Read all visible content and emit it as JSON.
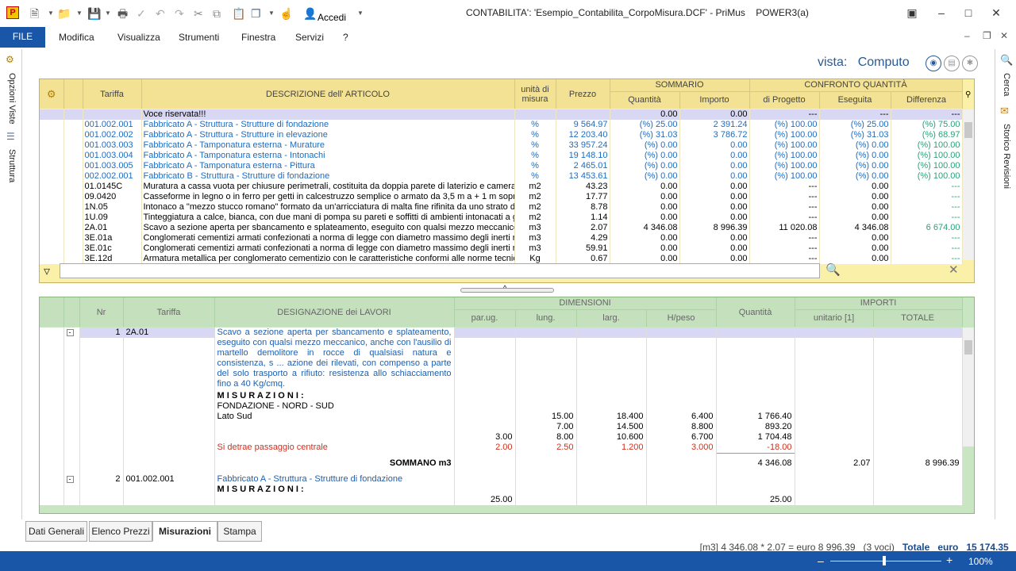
{
  "title": "CONTABILITA': 'Esempio_Contabilita_CorpoMisura.DCF' - PriMus    POWER3(a)",
  "toolbar": {
    "accedi": "Accedi"
  },
  "menu": {
    "file": "FILE",
    "items": [
      "Modifica",
      "Visualizza",
      "Strumenti",
      "Finestra",
      "Servizi",
      "?"
    ]
  },
  "left_tabs": [
    "Opzioni Viste",
    "Struttura"
  ],
  "right_tabs": [
    "Cerca",
    "Storico Revisioni"
  ],
  "vista": {
    "label": "vista:",
    "value": "Computo"
  },
  "top_grid": {
    "headers": {
      "tariffa": "Tariffa",
      "descrizione": "DESCRIZIONE dell' ARTICOLO",
      "um": "unità di misura",
      "prezzo": "Prezzo",
      "sommario": "SOMMARIO",
      "quantita": "Quantità",
      "importo": "Importo",
      "confronto": "CONFRONTO QUANTITÀ",
      "progetto": "di Progetto",
      "eseguita": "Eseguita",
      "differenza": "Differenza"
    },
    "rows": [
      {
        "t": "",
        "d": "Voce riservata!!!",
        "u": "",
        "p": "",
        "q": "0.00",
        "i": "0.00",
        "dp": "---",
        "e": "---",
        "df": "---",
        "style": "hl"
      },
      {
        "t": "001.002.001",
        "d": "Fabbricato A - Struttura - Strutture di fondazione",
        "u": "%",
        "p": "9 564.97",
        "q": "(%) 25.00",
        "i": "2 391.24",
        "dp": "(%) 100.00",
        "e": "(%) 25.00",
        "df": "(%) 75.00",
        "style": "blue"
      },
      {
        "t": "001.002.002",
        "d": "Fabbricato A - Struttura - Strutture in elevazione",
        "u": "%",
        "p": "12 203.40",
        "q": "(%) 31.03",
        "i": "3 786.72",
        "dp": "(%) 100.00",
        "e": "(%) 31.03",
        "df": "(%) 68.97",
        "style": "blue"
      },
      {
        "t": "001.003.003",
        "d": "Fabbricato A - Tamponatura esterna - Murature",
        "u": "%",
        "p": "33 957.24",
        "q": "(%) 0.00",
        "i": "0.00",
        "dp": "(%) 100.00",
        "e": "(%) 0.00",
        "df": "(%) 100.00",
        "style": "blue"
      },
      {
        "t": "001.003.004",
        "d": "Fabbricato A - Tamponatura esterna - Intonachi",
        "u": "%",
        "p": "19 148.10",
        "q": "(%) 0.00",
        "i": "0.00",
        "dp": "(%) 100.00",
        "e": "(%) 0.00",
        "df": "(%) 100.00",
        "style": "blue"
      },
      {
        "t": "001.003.005",
        "d": "Fabbricato A - Tamponatura esterna - Pittura",
        "u": "%",
        "p": "2 465.01",
        "q": "(%) 0.00",
        "i": "0.00",
        "dp": "(%) 100.00",
        "e": "(%) 0.00",
        "df": "(%) 100.00",
        "style": "blue"
      },
      {
        "t": "002.002.001",
        "d": "Fabbricato B - Struttura - Strutture di fondazione",
        "u": "%",
        "p": "13 453.61",
        "q": "(%) 0.00",
        "i": "0.00",
        "dp": "(%) 100.00",
        "e": "(%) 0.00",
        "df": "(%) 100.00",
        "style": "blue"
      },
      {
        "t": "01.0145C",
        "d": "Muratura a cassa vuota per chiusure perimetrali, costituita da doppia parete di laterizio e camera",
        "u": "m2",
        "p": "43.23",
        "q": "0.00",
        "i": "0.00",
        "dp": "---",
        "e": "0.00",
        "df": "---",
        "style": ""
      },
      {
        "t": "09.0420",
        "d": "Casseforme in legno o in ferro per getti in calcestruzzo semplice o armato da 3,5 m a + 1 m sopra",
        "u": "m2",
        "p": "17.77",
        "q": "0.00",
        "i": "0.00",
        "dp": "---",
        "e": "0.00",
        "df": "---",
        "style": ""
      },
      {
        "t": "1N.05",
        "d": "Intonaco a \"mezzo stucco romano\" formato da un'arricciatura di malta fine rifinita da uno strato d",
        "u": "m2",
        "p": "8.78",
        "q": "0.00",
        "i": "0.00",
        "dp": "---",
        "e": "0.00",
        "df": "---",
        "style": ""
      },
      {
        "t": "1U.09",
        "d": "Tinteggiatura a calce, bianca, con due mani di pompa su pareti e soffitti di ambienti intonacati a g",
        "u": "m2",
        "p": "1.14",
        "q": "0.00",
        "i": "0.00",
        "dp": "---",
        "e": "0.00",
        "df": "---",
        "style": ""
      },
      {
        "t": "2A.01",
        "d": "Scavo a sezione aperta per sbancamento e splateamento, eseguito con qualsi mezzo meccanico,",
        "u": "m3",
        "p": "2.07",
        "q": "4 346.08",
        "i": "8 996.39",
        "dp": "11 020.08",
        "e": "4 346.08",
        "df": "6 674.00",
        "style": ""
      },
      {
        "t": "3E.01a",
        "d": "Conglomerati cementizi armati confezionati a norma di legge con diametro massimo degli inerti nor",
        "u": "m3",
        "p": "4.29",
        "q": "0.00",
        "i": "0.00",
        "dp": "---",
        "e": "0.00",
        "df": "---",
        "style": ""
      },
      {
        "t": "3E.01c",
        "d": "Conglomerati cementizi armati confezionati a norma di legge con diametro massimo degli inerti nor",
        "u": "m3",
        "p": "59.91",
        "q": "0.00",
        "i": "0.00",
        "dp": "---",
        "e": "0.00",
        "df": "---",
        "style": ""
      },
      {
        "t": "3E.12d",
        "d": "Armatura metallica per conglomerato cementizio con le caratteristiche conformi alle norme tecnich",
        "u": "Kg",
        "p": "0.67",
        "q": "0.00",
        "i": "0.00",
        "dp": "---",
        "e": "0.00",
        "df": "---",
        "style": ""
      }
    ]
  },
  "bottom_grid": {
    "headers": {
      "nr": "Nr",
      "tariffa": "Tariffa",
      "designazione": "DESIGNAZIONE dei LAVORI",
      "dimensioni": "DIMENSIONI",
      "parug": "par.ug.",
      "lung": "lung.",
      "larg": "larg.",
      "hpeso": "H/peso",
      "quantita": "Quantità",
      "importi": "IMPORTI",
      "unitario": "unitario [1]",
      "totale": "TOTALE"
    },
    "item1": {
      "nr": "1",
      "tariffa": "2A.01",
      "descrizione": "Scavo a sezione aperta per sbancamento e splateamento, eseguito con qualsi mezzo meccanico, anche con l'ausilio di martello demolitore in rocce di qualsiasi natura e consistenza, s ... azione dei rilevati, con compenso a parte del solo trasporto a rifiuto: resistenza allo schiacciamento fino a 40 Kg/cmq.",
      "misurazioni": "M I S U R A Z I O N I :",
      "lines": [
        {
          "label": "FONDAZIONE - NORD - SUD",
          "pu": "",
          "lu": "",
          "la": "",
          "h": "",
          "q": "",
          "red": false
        },
        {
          "label": "Lato Sud",
          "pu": "",
          "lu": "15.00",
          "la": "18.400",
          "h": "6.400",
          "q": "1 766.40",
          "red": false
        },
        {
          "label": "",
          "pu": "",
          "lu": "7.00",
          "la": "14.500",
          "h": "8.800",
          "q": "893.20",
          "red": false
        },
        {
          "label": "",
          "pu": "3.00",
          "lu": "8.00",
          "la": "10.600",
          "h": "6.700",
          "q": "1 704.48",
          "red": false
        },
        {
          "label": "Si detrae passaggio centrale",
          "pu": "2.00",
          "lu": "2.50",
          "la": "1.200",
          "h": "3.000",
          "q": "-18.00",
          "red": true
        }
      ],
      "sommano_label": "SOMMANO m3",
      "sommano_q": "4 346.08",
      "unitario": "2.07",
      "totale": "8 996.39"
    },
    "item2": {
      "nr": "2",
      "tariffa": "001.002.001",
      "descrizione": "Fabbricato A - Struttura - Strutture di fondazione",
      "misurazioni": "M I S U R A Z I O N I :",
      "pu": "25.00",
      "q": "25.00"
    }
  },
  "sheet_tabs": [
    "Dati Generali",
    "Elenco Prezzi",
    "Misurazioni",
    "Stampa"
  ],
  "summary": {
    "text": "[m3] 4 346.08 * 2.07 = euro 8 996.39   (3 voci)",
    "totale_label": "Totale",
    "euro": "euro",
    "totale_value": "15 174.35"
  },
  "status": {
    "zoom": "100%"
  }
}
